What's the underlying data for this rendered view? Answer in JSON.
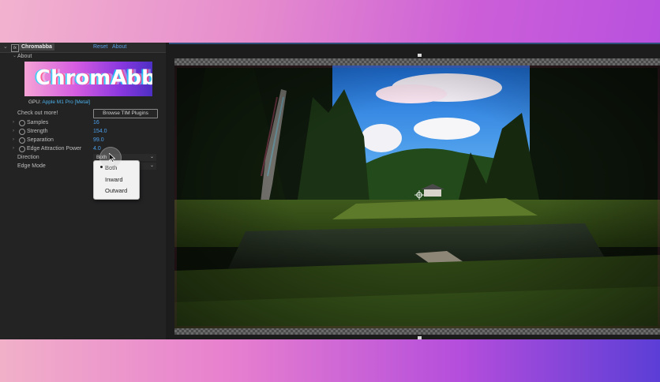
{
  "effect_panel": {
    "effect_name": "Chromabba",
    "fx_label": "fx",
    "reset_label": "Reset",
    "about_link": "About",
    "about_section": "About",
    "logo_text": "ChromAbba",
    "gpu_label": "GPU:",
    "gpu_value": "Apple M1 Pro [Metal]",
    "check_out_label": "Check out more!",
    "browse_button": "Browse TIM Plugins",
    "params": [
      {
        "label": "Samples",
        "value": "16"
      },
      {
        "label": "Strength",
        "value": "154.0"
      },
      {
        "label": "Separation",
        "value": "99.0"
      },
      {
        "label": "Edge Attraction Power",
        "value": "4.0"
      }
    ],
    "direction": {
      "label": "Direction",
      "selected": "Both"
    },
    "edge_mode": {
      "label": "Edge Mode"
    },
    "dropdown_options": [
      "Both",
      "Inward",
      "Outward"
    ]
  },
  "colors": {
    "value_blue": "#4c9ee8",
    "panel_bg": "#232324",
    "menu_bg": "#f1f1f1"
  },
  "icons": [
    "twirl-arrow-icon",
    "stopwatch-icon",
    "chevron-down-icon",
    "cursor-icon",
    "crosshair-icon"
  ]
}
